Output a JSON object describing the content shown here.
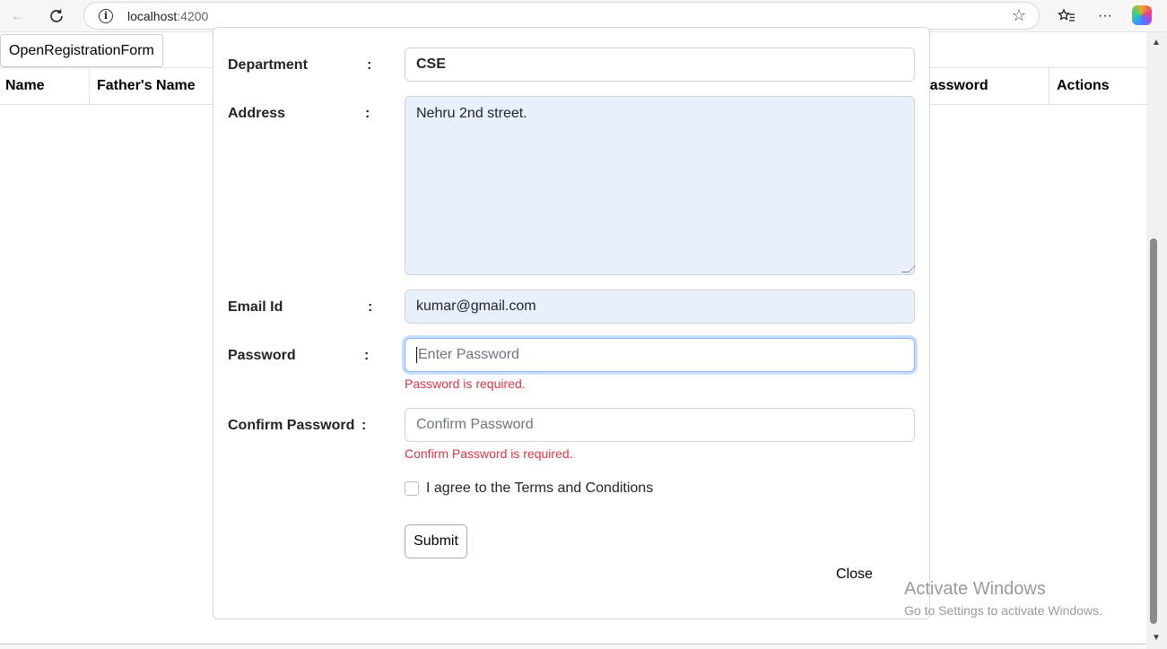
{
  "browser": {
    "url_host": "localhost",
    "url_port": ":4200",
    "back_icon": "arrow-left-icon",
    "reload_icon": "reload-icon"
  },
  "page": {
    "open_button_label": "OpenRegistrationForm",
    "table_headers": {
      "name": "Name",
      "father_name": "Father's Name",
      "password": "Password",
      "actions": "Actions"
    }
  },
  "form": {
    "department": {
      "label": "Department",
      "colon": ":",
      "value": "CSE"
    },
    "address": {
      "label": "Address",
      "colon": ":",
      "value": "Nehru 2nd street."
    },
    "email": {
      "label": "Email Id",
      "colon": ":",
      "value": "kumar@gmail.com"
    },
    "password": {
      "label": "Password",
      "colon": ":",
      "placeholder": "Enter Password",
      "error": "Password is required."
    },
    "confirm_password": {
      "label": "Confirm Password",
      "colon": ":",
      "placeholder": "Confirm Password",
      "error": "Confirm Password is required."
    },
    "terms_label": "I agree to the Terms and Conditions",
    "submit_label": "Submit",
    "close_label": "Close"
  },
  "watermark": {
    "title": "Activate Windows",
    "subtitle": "Go to Settings to activate Windows."
  },
  "colors": {
    "error": "#dc3545",
    "autofill_bg": "#e8f0fe",
    "focus_ring": "#86b7fe"
  }
}
